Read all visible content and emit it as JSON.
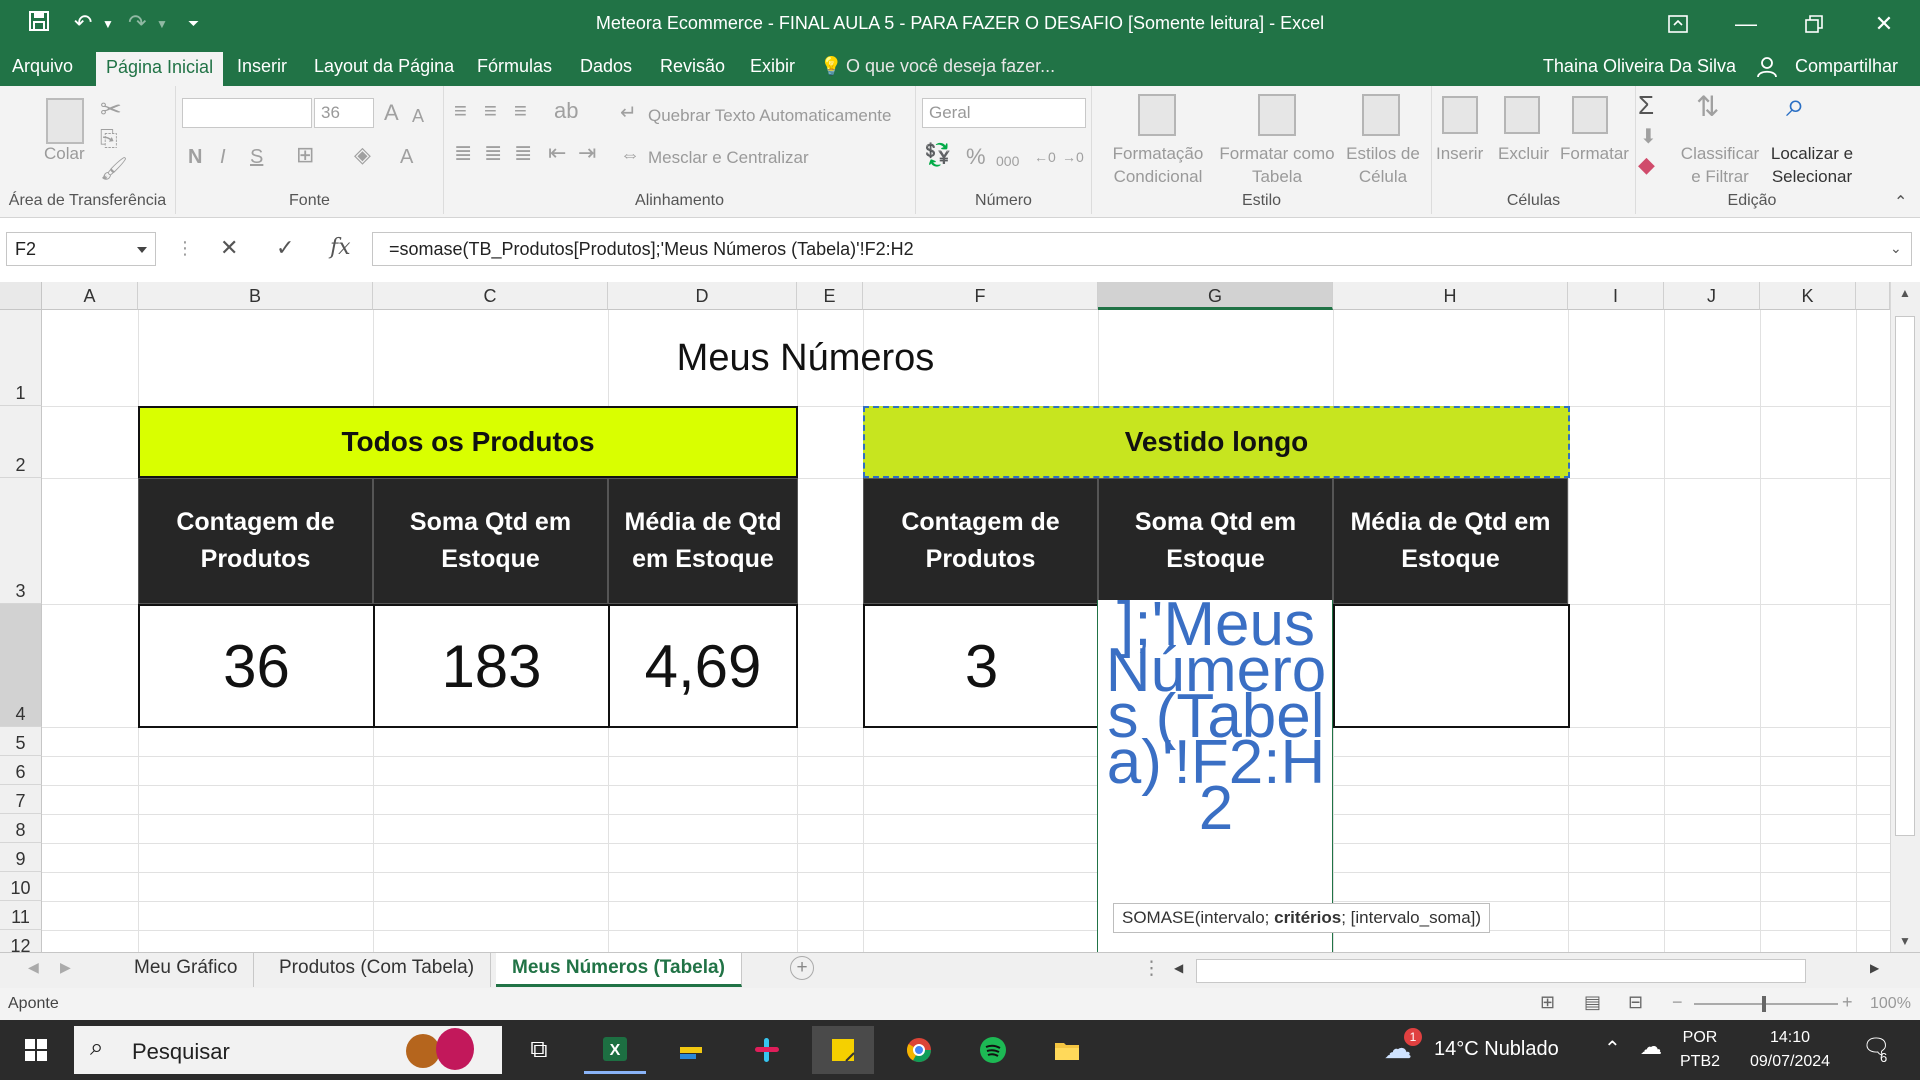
{
  "window": {
    "title": "Meteora Ecommerce - FINAL AULA 5 - PARA FAZER O DESAFIO  [Somente leitura] - Excel"
  },
  "menu": {
    "tabs": [
      "Arquivo",
      "Página Inicial",
      "Inserir",
      "Layout da Página",
      "Fórmulas",
      "Dados",
      "Revisão",
      "Exibir"
    ],
    "tell_me": "O que você deseja fazer...",
    "user": "Thaina Oliveira Da Silva",
    "share": "Compartilhar"
  },
  "ribbon": {
    "clipboard": {
      "paste": "Colar",
      "label": "Área de Transferência"
    },
    "font": {
      "size": "36",
      "bold": "N",
      "italic": "I",
      "underline": "S",
      "label": "Fonte"
    },
    "alignment": {
      "wrap": "Quebrar Texto Automaticamente",
      "merge": "Mesclar e Centralizar",
      "label": "Alinhamento"
    },
    "number": {
      "format": "Geral",
      "percent": "%",
      "thousands": "000",
      "label": "Número"
    },
    "styles": {
      "conditional": [
        "Formatação",
        "Condicional"
      ],
      "table": [
        "Formatar como",
        "Tabela"
      ],
      "cell": [
        "Estilos de",
        "Célula"
      ],
      "label": "Estilo"
    },
    "cells": {
      "insert": "Inserir",
      "delete": "Excluir",
      "format": "Formatar",
      "label": "Células"
    },
    "editing": {
      "sort": [
        "Classificar",
        "e Filtrar"
      ],
      "find": [
        "Localizar e",
        "Selecionar"
      ],
      "label": "Edição"
    }
  },
  "formula_bar": {
    "name_box": "F2",
    "cancel": "✕",
    "enter": "✓",
    "fx": "fx",
    "formula": "=somase(TB_Produtos[Produtos];'Meus Números (Tabela)'!F2:H2"
  },
  "grid": {
    "columns": [
      "A",
      "B",
      "C",
      "D",
      "E",
      "F",
      "G",
      "H",
      "I",
      "J",
      "K"
    ],
    "rows": [
      "1",
      "2",
      "3",
      "4",
      "5",
      "6",
      "7",
      "8",
      "9",
      "10",
      "11",
      "12"
    ],
    "title": "Meus Números",
    "table_all": {
      "header": "Todos os Produtos",
      "col1": "Contagem de Produtos",
      "col2": "Soma Qtd em Estoque",
      "col3": "Média de Qtd em Estoque",
      "count": "36",
      "sum": "183",
      "avg": "4,69",
      "header_color": "#d9ff00"
    },
    "table_dress": {
      "header": "Vestido longo",
      "col1": "Contagem de Produtos",
      "col2": "Soma Qtd em Estoque",
      "col3": "Média de Qtd em Estoque",
      "count": "3",
      "editing_text": "];'Meus Números (Tabela)'!F2:H2",
      "header_color": "#c7e51f"
    },
    "tooltip": {
      "fn": "SOMASE(intervalo; ",
      "arg": "critérios",
      "rest": "; [intervalo_soma])"
    }
  },
  "sheets": {
    "tabs": [
      "Meu Gráfico",
      "Produtos (Com Tabela)",
      "Meus Números (Tabela)"
    ],
    "active": "Meus Números (Tabela)"
  },
  "status": {
    "mode": "Aponte",
    "zoom": "100%"
  },
  "taskbar": {
    "search": "Pesquisar",
    "weather": "14°C  Nublado",
    "weather_badge": "1",
    "lang": [
      "POR",
      "PTB2"
    ],
    "time": "14:10",
    "date": "09/07/2024",
    "notifications": "6"
  },
  "colors": {
    "excel_green": "#217346",
    "dark_header": "#262626",
    "edit_blue": "#3a6fc4"
  }
}
